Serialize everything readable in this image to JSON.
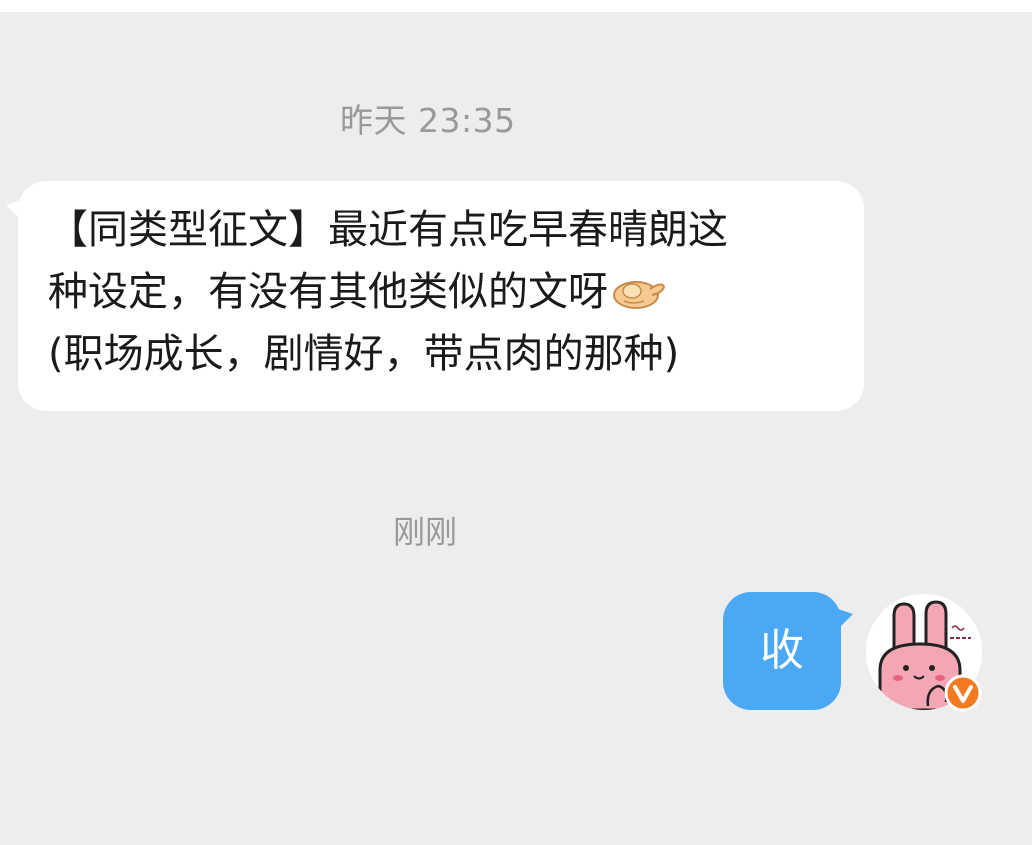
{
  "conversation": {
    "timestamp_1": "昨天 23:35",
    "incoming_message": {
      "line_1": "【同类型征文】最近有点吃早春晴朗这",
      "line_2": "种设定，有没有其他类似的文呀",
      "line_3": "(职场成长，剧情好，带点肉的那种)",
      "emoji": "pinching-hand-emoji"
    },
    "timestamp_2": "刚刚",
    "outgoing_message": {
      "text": "收"
    },
    "avatar": {
      "icon": "pink-rabbit-avatar",
      "badge_icon": "verified-v-badge-icon",
      "badge_letter": "V",
      "badge_color": "#f47a20"
    }
  },
  "colors": {
    "chat_background": "#ededed",
    "incoming_bubble": "#ffffff",
    "outgoing_bubble": "#4aa8f5",
    "timestamp_text": "#999999",
    "message_text": "#1a1a1a"
  }
}
